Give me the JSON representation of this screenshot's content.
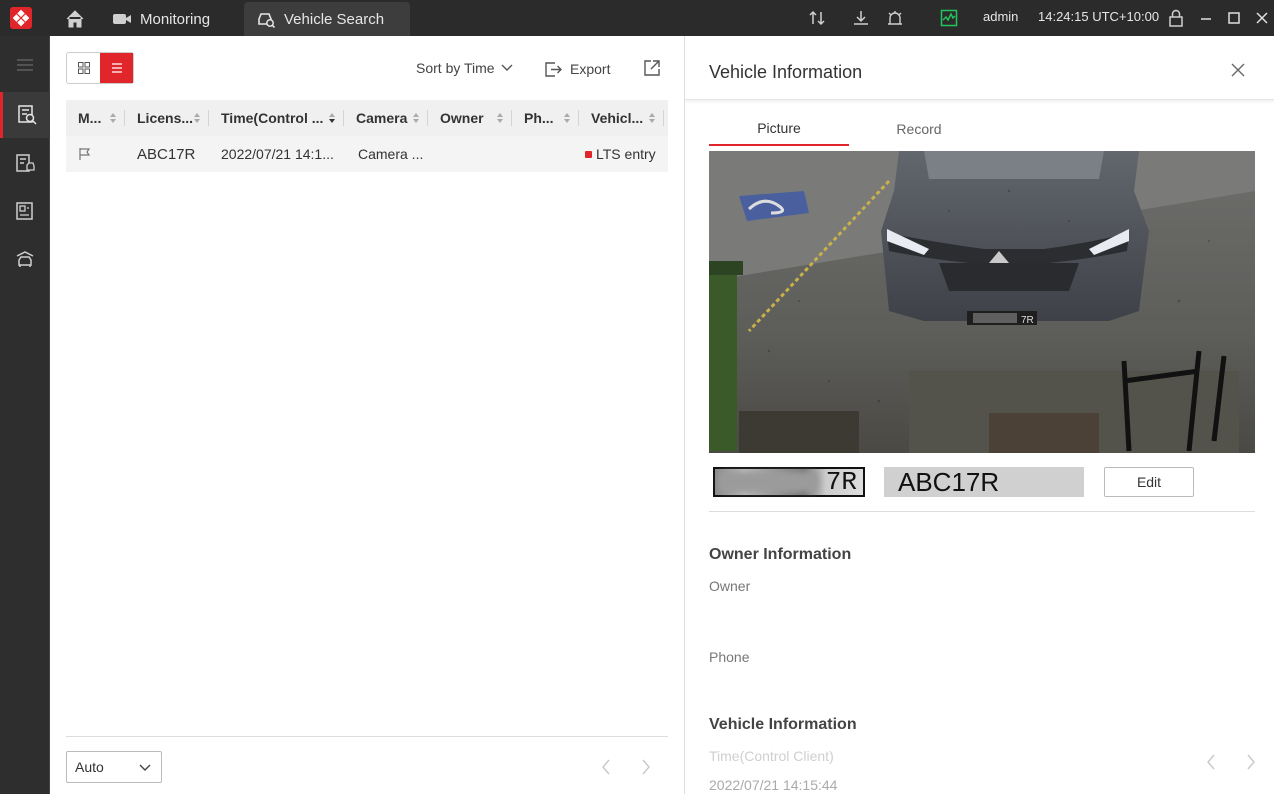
{
  "titlebar": {
    "tabs": [
      {
        "label": "Monitoring",
        "icon": "camera-icon"
      },
      {
        "label": "Vehicle Search",
        "icon": "car-search-icon"
      }
    ],
    "user": "admin",
    "clock": "14:24:15 UTC+10:00"
  },
  "toolbar": {
    "sort_label": "Sort by Time",
    "export_label": "Export"
  },
  "table": {
    "columns": [
      "M...",
      "Licens...",
      "Time(Control ...",
      "Camera",
      "Owner",
      "Ph...",
      "Vehicl..."
    ],
    "rows": [
      {
        "mark": "flag-icon",
        "license": "ABC17R",
        "time": "2022/07/21 14:1...",
        "camera": "Camera ...",
        "owner": "",
        "phone": "",
        "vehicle_list": "LTS entry"
      }
    ]
  },
  "footer": {
    "page_size": "Auto"
  },
  "detail": {
    "title": "Vehicle Information",
    "tabs": [
      "Picture",
      "Record"
    ],
    "plate_crop_visible": "7R",
    "plate_number": "ABC17R",
    "edit_label": "Edit",
    "owner_section": "Owner Information",
    "owner_label": "Owner",
    "phone_label": "Phone",
    "vehicle_section": "Vehicle Information",
    "time_label": "Time(Control Client)",
    "time_value": "2022/07/21 14:15:44"
  },
  "colors": {
    "accent": "#e0262b",
    "titlebar_bg": "#2b2b2b",
    "nav_bg": "#2e2e2e",
    "status_green": "#22c55e"
  }
}
